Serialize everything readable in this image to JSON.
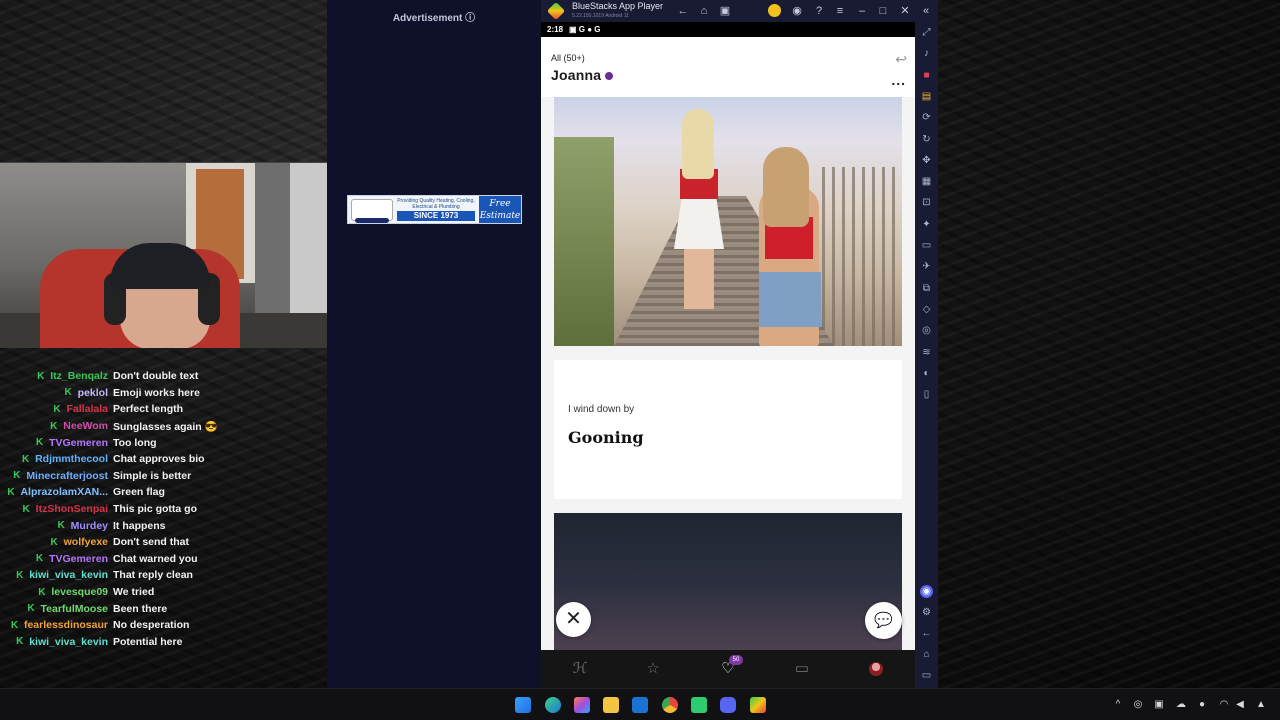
{
  "advertisement": {
    "label": "Advertisement ⓘ",
    "banner_text_1": "Providing Quality Heating, Cooling,",
    "banner_text_2": "Electrical & Plumbing",
    "banner_since": "SINCE 1973",
    "banner_free": "Free Estimate"
  },
  "chat": {
    "badge_icon": "K",
    "messages": [
      {
        "user": "Itz_Benqalz",
        "color": "#36c955",
        "text": "Don't double text"
      },
      {
        "user": "peklol",
        "color": "#c8b8ff",
        "text": "Emoji works here"
      },
      {
        "user": "Fallalala",
        "color": "#d8324a",
        "text": "Perfect length"
      },
      {
        "user": "NeeWom",
        "color": "#d14fa9",
        "text": "Sunglasses again 😎"
      },
      {
        "user": "TVGemeren",
        "color": "#b575ff",
        "text": "Too long"
      },
      {
        "user": "Rdjmmthecool",
        "color": "#5db4ff",
        "text": "Chat approves bio"
      },
      {
        "user": "Minecrafterjoost",
        "color": "#6fb0ff",
        "text": "Simple is better"
      },
      {
        "user": "AlprazolamXAN...",
        "color": "#7fc0ff",
        "text": "Green flag"
      },
      {
        "user": "ItzShonSenpai",
        "color": "#d8324a",
        "text": "This pic gotta go"
      },
      {
        "user": "Murdey",
        "color": "#a08cff",
        "text": "It happens"
      },
      {
        "user": "wolfyexe",
        "color": "#f2a23a",
        "text": "Don't send that"
      },
      {
        "user": "TVGemeren",
        "color": "#b575ff",
        "text": "Chat warned you"
      },
      {
        "user": "kiwi_viva_kevin",
        "color": "#5fe0d0",
        "text": "That reply clean"
      },
      {
        "user": "levesque09",
        "color": "#6fd96f",
        "text": "We tried"
      },
      {
        "user": "TearfulMoose",
        "color": "#6fd96f",
        "text": "Been there"
      },
      {
        "user": "fearlessdinosaur",
        "color": "#f2a23a",
        "text": "No desperation"
      },
      {
        "user": "kiwi_viva_kevin",
        "color": "#5fe0d0",
        "text": "Potential here"
      }
    ]
  },
  "bluestacks": {
    "title": "BlueStacks App Player",
    "version": "5.22.150.1019 Android 11",
    "titlebar_icons": [
      "back-icon",
      "home-icon",
      "multi-instance-icon",
      "coin-icon",
      "account-icon",
      "help-icon",
      "menu-icon",
      "minimize-icon",
      "maximize-icon",
      "close-icon",
      "collapse-icon"
    ],
    "sidebar_icons": [
      "fullscreen-icon",
      "volume-icon",
      "record-icon",
      "media-icon",
      "rotate-icon",
      "refresh-icon",
      "gamepad-icon",
      "screenshot-icon",
      "capture-icon",
      "macro-icon",
      "folder-icon",
      "airplane-icon",
      "multi-instance-icon",
      "eraser-icon",
      "location-icon",
      "layers-icon",
      "eco-icon",
      "book-icon"
    ],
    "sidebar_bottom_icons": [
      "discord-icon",
      "settings-icon",
      "back-icon",
      "home-icon",
      "recents-icon"
    ]
  },
  "android": {
    "status_time": "2:18",
    "status_icons": "▣ G ● G"
  },
  "profile": {
    "filter_label": "All (50+)",
    "name": "Joanna",
    "more_label": "...",
    "prompt_question": "I wind down by",
    "prompt_answer": "Gooning",
    "close_label": "✕",
    "comment_label": "💬"
  },
  "bottom_nav": {
    "like_count": "50",
    "items": [
      "discover-icon",
      "standouts-icon",
      "likes-icon",
      "matches-icon",
      "profile-icon"
    ]
  },
  "taskbar": {
    "apps": [
      "start-icon",
      "edge-icon",
      "copilot-icon",
      "file-explorer-icon",
      "outlook-icon",
      "chrome-icon",
      "whatsapp-icon",
      "discord-icon",
      "bluestacks-icon"
    ]
  }
}
